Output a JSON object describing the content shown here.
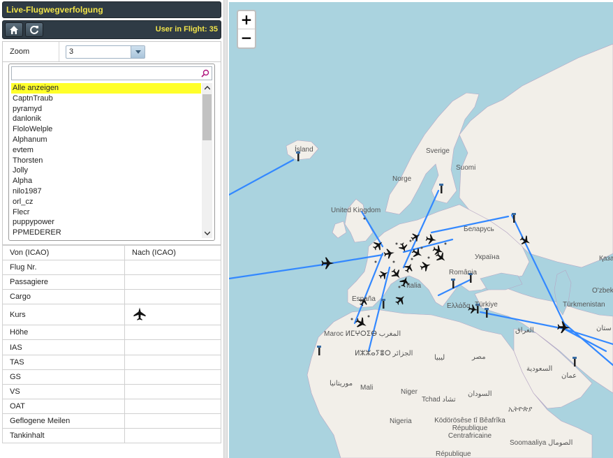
{
  "header": {
    "title": "Live-Flugwegverfolgung",
    "users_in_flight": "User in Flight: 35"
  },
  "toolbar": {
    "home_icon": "home-icon",
    "refresh_icon": "refresh-icon"
  },
  "zoom": {
    "label": "Zoom",
    "value": "3"
  },
  "pilot_list": {
    "search_value": "",
    "items": [
      "Alle anzeigen",
      "CaptnTraub",
      "pyramyd",
      "danlonik",
      "FloloWelple",
      "Alphanum",
      "evtem",
      "Thorsten",
      "Jolly",
      "Alpha",
      "nilo1987",
      "orl_cz",
      "Flecr",
      "puppypower",
      "PPMEDERER"
    ],
    "selected": "Alle anzeigen"
  },
  "flight_info": {
    "columns": [
      "Von (ICAO)",
      "Nach (ICAO)"
    ],
    "rows": [
      "Flug Nr.",
      "Passagiere",
      "Cargo",
      "Kurs",
      "Höhe",
      "IAS",
      "TAS",
      "GS",
      "VS",
      "OAT",
      "Geflogene Meilen",
      "Tankinhalt"
    ]
  },
  "map": {
    "zoom_in": "+",
    "zoom_out": "−",
    "labels": [
      "Ísland",
      "Sverige",
      "Suomi",
      "Norge",
      "United Kingdom",
      "Беларусь",
      "Україна",
      "România",
      "Italia",
      "España",
      "Ελλάδα",
      "Türkiye",
      "Қаза",
      "O'zbekis",
      "Türkmenistan",
      "Маroc ⵍⵎⵖⵔⵉⴱ المغرب",
      "ⵍⵣⵣⴰⵢⴻⵔ الجزائر",
      "ليبيا",
      "مصر",
      "العراق",
      "السعودية",
      "عمان",
      "ستان",
      "موريتانيا",
      "Mali",
      "Niger",
      "Tchad تشاد",
      "السودان",
      "ኢትዮጵያ",
      "Nigeria",
      "Ködörösêse tî Bêafrîka République Centrafricaine",
      "Soomaaliya الصومال",
      "République"
    ],
    "colors": {
      "sea": "#aad3df",
      "land": "#f2efe9",
      "route": "#3388ff",
      "border": "#b6a6c4"
    }
  }
}
